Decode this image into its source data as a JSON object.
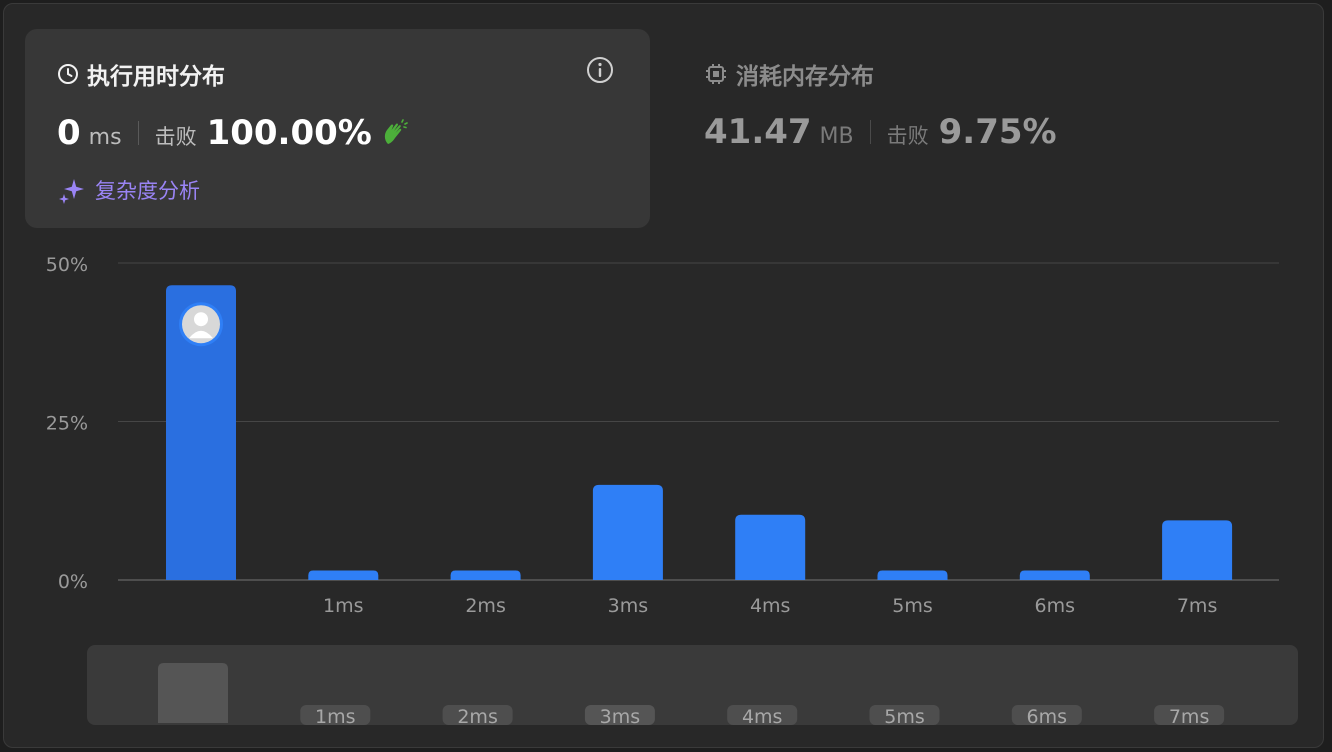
{
  "runtime_card": {
    "title": "执行用时分布",
    "value": "0",
    "unit": "ms",
    "beat_label": "击败",
    "beat_pct": "100.00%",
    "complexity_label": "复杂度分析",
    "icons": [
      "clock-icon",
      "info-icon",
      "clap-icon",
      "sparkle-icon"
    ]
  },
  "memory_card": {
    "title": "消耗内存分布",
    "value": "41.47",
    "unit": "MB",
    "beat_label": "击败",
    "beat_pct": "9.75%",
    "icons": [
      "chip-icon"
    ]
  },
  "colors": {
    "bar": "#2f7ff6",
    "bar_highlight": "#2a6fe0",
    "accent_purple": "#9a84f5",
    "clap_green": "#4caf3a"
  },
  "chart_data": {
    "type": "bar",
    "categories": [
      "",
      "1ms",
      "2ms",
      "3ms",
      "4ms",
      "5ms",
      "6ms",
      "7ms"
    ],
    "values": [
      46.5,
      1.5,
      1.5,
      15,
      10.3,
      1.5,
      1.5,
      9.4
    ],
    "highlight_index": 0,
    "ylim": [
      0,
      50
    ],
    "yticks": [
      "0%",
      "25%",
      "50%"
    ],
    "ytick_values": [
      0,
      25,
      50
    ],
    "grid": true,
    "legend": "none"
  },
  "navigator": {
    "labels": [
      "",
      "1ms",
      "2ms",
      "3ms",
      "4ms",
      "5ms",
      "6ms",
      "7ms"
    ],
    "active_index": 3
  }
}
